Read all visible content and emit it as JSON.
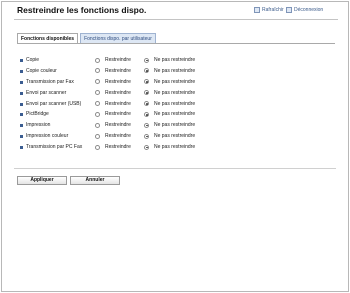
{
  "header": {
    "title": "Restreindre les fonctions dispo.",
    "refresh_label": "Rafraîchir",
    "logout_label": "Déconnexion"
  },
  "tabs": [
    {
      "label": "Fonctions disponibles",
      "active": true
    },
    {
      "label": "Fonctions dispo. par utilisateur",
      "active": false
    }
  ],
  "options": {
    "restrict": "Restreindre",
    "no_restrict": "Ne pas restreindre"
  },
  "functions": [
    {
      "label": "Copie",
      "selected": "no_restrict"
    },
    {
      "label": "Copie couleur",
      "selected": "no_restrict"
    },
    {
      "label": "Transmission par Fax",
      "selected": "no_restrict"
    },
    {
      "label": "Envoi par scanner",
      "selected": "no_restrict"
    },
    {
      "label": "Envoi par scanner (USB)",
      "selected": "no_restrict"
    },
    {
      "label": "PictBridge",
      "selected": "no_restrict"
    },
    {
      "label": "Impression",
      "selected": "no_restrict"
    },
    {
      "label": "Impression couleur",
      "selected": "no_restrict"
    },
    {
      "label": "Transmission par PC Fax",
      "selected": "no_restrict"
    }
  ],
  "actions": {
    "apply_label": "Appliquer",
    "cancel_label": "Annuler"
  }
}
